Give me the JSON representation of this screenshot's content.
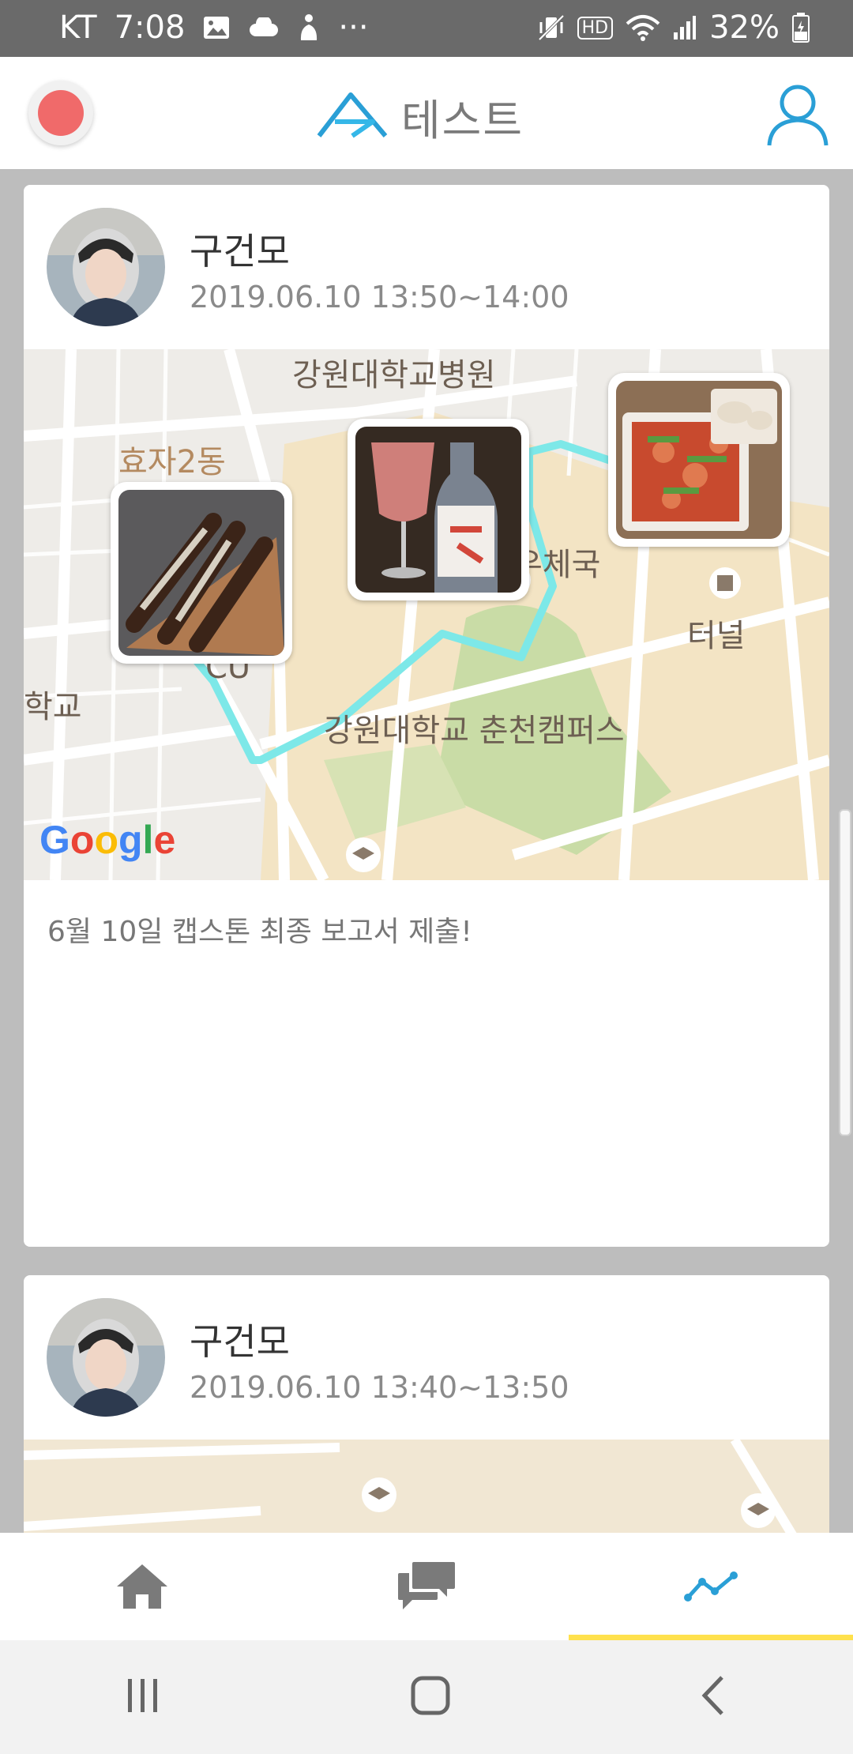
{
  "status_bar": {
    "carrier": "KT",
    "time": "7:08",
    "more": "···",
    "battery": "32%",
    "network_badge": "HD"
  },
  "app_bar": {
    "title": "테스트",
    "brand_color": "#2a9fd6",
    "record_color": "#f06a6a"
  },
  "feed": [
    {
      "author": "구건모",
      "time_range": "2019.06.10 13:50~14:00",
      "map": {
        "labels": [
          "강원대학교병원",
          "효자2동",
          "우체국",
          "터널",
          "CU",
          "학교",
          "강원대학교 춘천캠퍼스"
        ],
        "route_color": "#7de8e8",
        "attribution": "Google"
      },
      "caption": "6월 10일 캡스톤 최종 보고서 제출!"
    },
    {
      "author": "구건모",
      "time_range": "2019.06.10 13:40~13:50"
    }
  ],
  "bottom_nav": {
    "items": [
      {
        "name": "home",
        "icon": "home-icon"
      },
      {
        "name": "chat",
        "icon": "chat-icon"
      },
      {
        "name": "timeline",
        "icon": "trend-icon",
        "active": true
      }
    ],
    "active_color": "#2a9fd6",
    "indicator_color": "#ffe14d"
  }
}
